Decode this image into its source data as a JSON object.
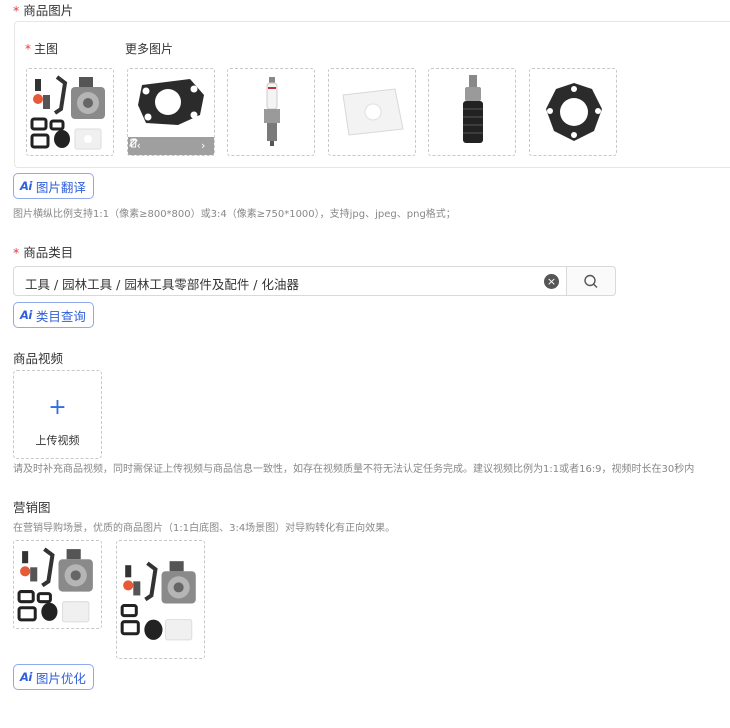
{
  "product_images": {
    "required_mark": "*",
    "title": "商品图片",
    "main_label_required": "*",
    "main_label": "主图",
    "more_label": "更多图片",
    "ai_badge": "Ai",
    "translate_button": "图片翻译",
    "hint": "图片横纵比例支持1:1（像素≥800*800）或3:4（像素≥750*1000），支持jpg、jpeg、png格式；"
  },
  "category": {
    "required_mark": "*",
    "title": "商品类目",
    "value": "工具 / 园林工具 / 园林工具零部件及配件 / 化油器",
    "ai_badge": "Ai",
    "query_button": "类目查询"
  },
  "video": {
    "title": "商品视频",
    "upload_plus": "+",
    "upload_label": "上传视频",
    "hint": "请及时补充商品视频，同时需保证上传视频与商品信息一致性，如存在视频质量不符无法认定任务完成。建议视频比例为1:1或者16:9，视频时长在30秒内"
  },
  "marketing": {
    "title": "营销图",
    "hint": "在营销导购场景，优质的商品图片（1:1白底图、3:4场景图）对导购转化有正向效果。",
    "ai_badge": "Ai",
    "optimize_button": "图片优化"
  },
  "colors": {
    "accent": "#2f5fd9",
    "required": "#e4393c",
    "border": "#d9d9d9"
  },
  "icons": {
    "thumb_prev": "‹",
    "thumb_next": "›"
  }
}
